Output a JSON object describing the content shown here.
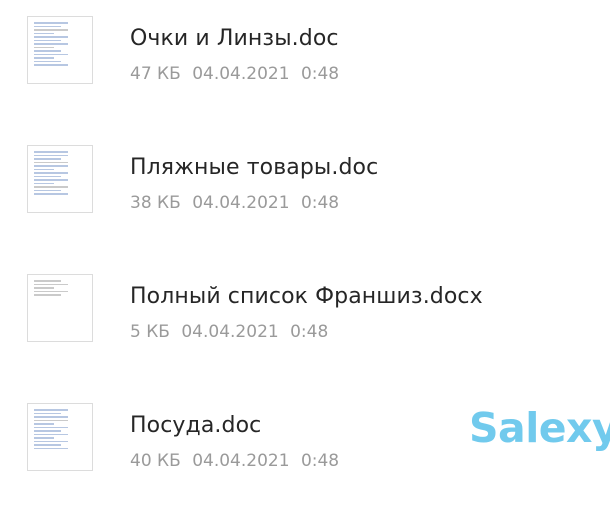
{
  "files": [
    {
      "name": "Очки и Линзы.doc",
      "size": "47 КБ",
      "date": "04.04.2021",
      "time": "0:48",
      "icon": "document-thumbnail-icon"
    },
    {
      "name": "Пляжные товары.doc",
      "size": "38 КБ",
      "date": "04.04.2021",
      "time": "0:48",
      "icon": "document-thumbnail-icon"
    },
    {
      "name": "Полный список Франшиз.docx",
      "size": "5 КБ",
      "date": "04.04.2021",
      "time": "0:48",
      "icon": "document-thumbnail-icon"
    },
    {
      "name": "Посуда.doc",
      "size": "40 КБ",
      "date": "04.04.2021",
      "time": "0:48",
      "icon": "document-thumbnail-icon"
    }
  ],
  "watermark": {
    "text": "Salexy",
    "color": "#62c5ec"
  }
}
